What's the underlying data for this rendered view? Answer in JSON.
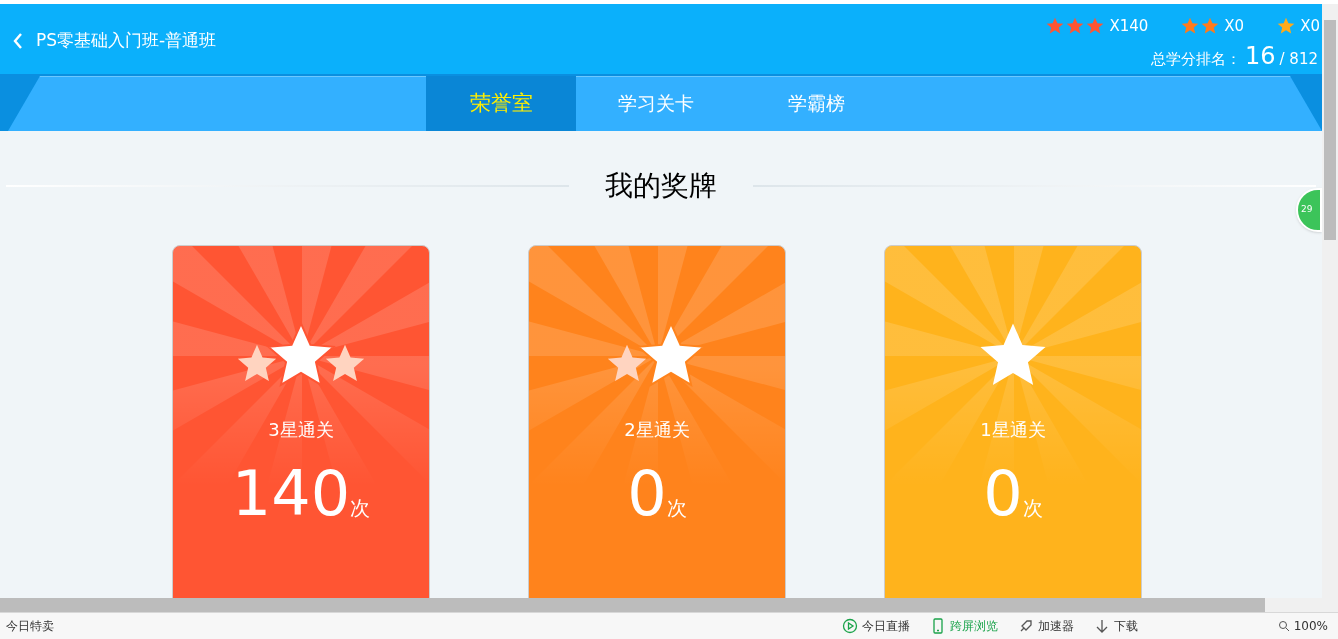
{
  "header": {
    "title": "PS零基础入门班-普通班",
    "star_totals": [
      {
        "kind": "three_star",
        "color": "#ff5533",
        "count": "X140"
      },
      {
        "kind": "two_star",
        "color": "#ff7a1a",
        "count": "X0"
      },
      {
        "kind": "one_star",
        "color": "#ffaa1a",
        "count": "X0"
      }
    ],
    "rank_label": "总学分排名：",
    "rank": "16",
    "rank_total": "/ 812"
  },
  "tabs": [
    {
      "label": "荣誉室",
      "selected": true
    },
    {
      "label": "学习关卡",
      "selected": false
    },
    {
      "label": "学霸榜",
      "selected": false
    }
  ],
  "section_title": "我的奖牌",
  "medals": [
    {
      "kind": "three_star",
      "color": "#ff5533",
      "title": "3星通关",
      "count": "140",
      "unit": "次"
    },
    {
      "kind": "two_star",
      "color": "#ff831c",
      "title": "2星通关",
      "count": "0",
      "unit": "次"
    },
    {
      "kind": "one_star",
      "color": "#ffb31c",
      "title": "1星通关",
      "count": "0",
      "unit": "次"
    }
  ],
  "side_badge": "29",
  "status_bar": {
    "left": "今日特卖",
    "items": [
      {
        "kind": "play",
        "label": "今日直播",
        "highlight": false
      },
      {
        "kind": "phone",
        "label": "跨屏浏览",
        "highlight": true
      },
      {
        "kind": "accel",
        "label": "加速器",
        "highlight": false
      },
      {
        "kind": "download",
        "label": "下载",
        "highlight": false
      }
    ],
    "zoom": "100%"
  }
}
